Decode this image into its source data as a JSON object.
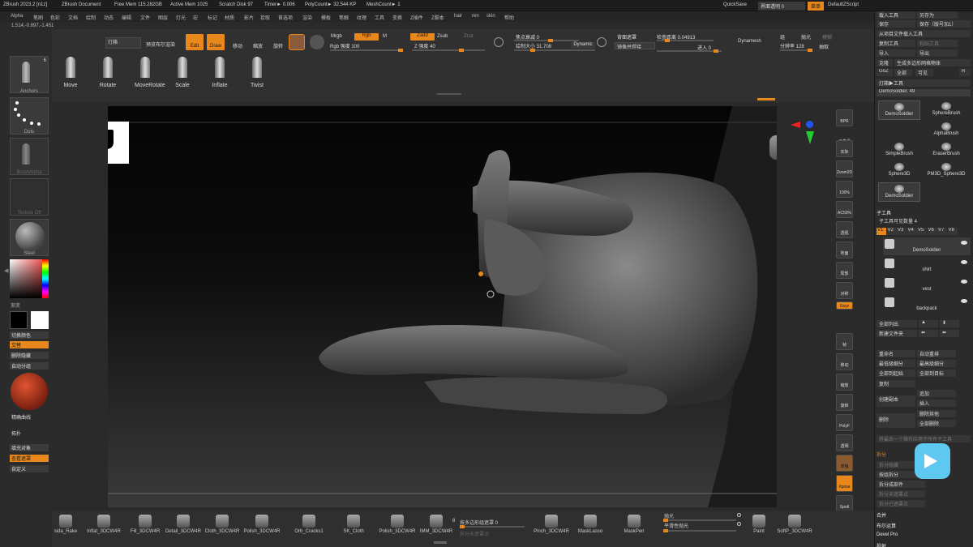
{
  "titlebar": {
    "app": "ZBrush 2023.2 [n1z]",
    "doc": "ZBrush Document",
    "freemem": "Free Mem 115.282GB",
    "activemem": "Active Mem 1025",
    "scratch": "Scratch Disk 97",
    "timer": "Timer► 0.006",
    "polycount": "PolyCount► 32.544 KP",
    "meshcount": "MeshCount► 1",
    "quicksave_label": "QuickSave",
    "transparency_label": "界面透明 0",
    "menu_label": "菜单",
    "script_label": "DefaultZScript"
  },
  "menu": [
    "Alpha",
    "笔刷",
    "色彩",
    "文档",
    "绘制",
    "动态",
    "编辑",
    "文件",
    "图层",
    "灯光",
    "宏",
    "标记",
    "材质",
    "影片",
    "拾取",
    "首选项",
    "渲染",
    "模板",
    "笔触",
    "纹理",
    "工具",
    "变换",
    "Z插件",
    "Z脚本",
    "hair",
    "ren",
    "skin",
    "帮助"
  ],
  "coords": "1.514,-0.897,-1.451",
  "top": {
    "lightbox": "灯箱",
    "preview": "预览布尔渲染",
    "edit": "Edit",
    "draw": "Draw",
    "move": "移动",
    "scale": "缩放",
    "rotate": "旋转",
    "mrgb": "Mrgb",
    "rgb": "Rgb",
    "m": "M",
    "rgb_intensity": "Rgb 强度 100",
    "zadd": "Zadd",
    "zsub": "Zsub",
    "zcut": "Zcut",
    "z_intensity": "Z 强度 40",
    "focal": "焦点衰减 0",
    "draw_size": "绘制大小 31.708",
    "dynamic": "Dynamic",
    "backface": "背面遮罩",
    "mirror": "镜像并焊接",
    "check_dist": "检查距离 0.04913",
    "advance": "进入 0",
    "dynamesh": "Dynamesh",
    "group": "组",
    "polish": "抛光",
    "resolution": "分辨率 128",
    "blur": "模糊",
    "extract": "抽取"
  },
  "brushes": [
    {
      "label": "Move"
    },
    {
      "label": "Rotate"
    },
    {
      "label": "MoveRotate"
    },
    {
      "label": "Scale"
    },
    {
      "label": "Inflate"
    },
    {
      "label": "Twist"
    }
  ],
  "left": {
    "anchors": "Anchors",
    "anchors_count": "6",
    "dots": "Dots",
    "brushalpha": "BrushAlpha",
    "textureoff": "Texture Off",
    "steel": "Steel",
    "gradient": "渐变",
    "swap_color": "切换颜色",
    "alternate": "交替",
    "delete_hide": "删除隐藏",
    "auto_group": "自动分组",
    "precise_curve": "精确曲线",
    "expand": "拓扑",
    "fill_object": "填充对象",
    "view_mask": "查看遮罩",
    "custom": "自定义"
  },
  "rtool": {
    "bpr": "BPR",
    "subpix": "子像素",
    "actual": "实际",
    "zoom2d": "Zoom2D",
    "pct100": "100%",
    "ac50": "AC50%",
    "persp": "透视",
    "floor": "地面",
    "local": "局部",
    "dynamic": "Dynamic",
    "sym": "对称",
    "xyz": "Gxyz",
    "frame": "帧",
    "move": "移动",
    "scale": "缩放",
    "rotate": "旋转",
    "polyf": "PolyF",
    "transp": "透明",
    "ghost": "幽灵",
    "solo": "单独",
    "xpose": "Xpose",
    "spotlight": "Spotl"
  },
  "rpanel": {
    "load": "载入工具",
    "saveas": "另存为",
    "save": "保存",
    "save_version": "保存（版号加1）",
    "import_proj": "从项目文件载入工具",
    "copy_tool": "复制工具",
    "paste": "粘贴工具",
    "import": "导入",
    "export": "导出",
    "clone": "克隆",
    "make_polymesh": "生成多边形网格物体",
    "goz": "GoZ",
    "all": "全部",
    "visible": "可见",
    "r": "R",
    "lightbox_tool": "灯箱▶工具",
    "current_tool": "DemoSoldier. 49",
    "tools": [
      {
        "label": "DemoSoldier"
      },
      {
        "label": "SphereBrush"
      },
      {
        "label": "AlphaBrush"
      },
      {
        "label": "SimpleBrush"
      },
      {
        "label": "EraserBrush"
      },
      {
        "label": "Sphere3D"
      },
      {
        "label": "PM3D_Sphere3D"
      },
      {
        "label": "DemoSoldier"
      }
    ],
    "subtool": "子工具",
    "subtool_count": "子工具可见数量 4",
    "vtabs": [
      "V1",
      "V2",
      "V3",
      "V4",
      "V5",
      "V6",
      "V7",
      "V8"
    ],
    "subtools": [
      {
        "label": "DemoSoldier"
      },
      {
        "label": "shirt"
      },
      {
        "label": "vest"
      },
      {
        "label": "backpack"
      }
    ],
    "list_all": "全部列出",
    "new_folder": "新建文件夹",
    "rename": "重命名",
    "auto_reorder": "自动重排",
    "lowest_res": "最低级细分",
    "highest_res": "最高级细分",
    "all_low": "全部到起始",
    "all_high": "全部到目标",
    "duplicate": "复制",
    "append": "追加",
    "insert": "插入",
    "create_copy": "创建副本",
    "delete": "删除",
    "delete_other": "删除其他",
    "delete_all": "全部删除",
    "merge_note": "将最后一个操作应用于所有子工具",
    "split": "拆分",
    "split_hidden": "拆分隐藏",
    "groups_split": "按组拆分",
    "split_parts": "拆分成部件",
    "split_unmasked": "拆分未遮罩点",
    "split_masked": "拆分已遮罩点",
    "merge": "合并",
    "boolean": "布尔运算",
    "remesh": "Devel Pro",
    "project": "投射"
  },
  "bottom": {
    "items": [
      {
        "label": "sida_Rake"
      },
      {
        "label": "Inflat_3DCW4R"
      },
      {
        "label": "Fill_3DCW4R"
      },
      {
        "label": "Detail_3DCW4R"
      },
      {
        "label": "Cloth_3DCW4R"
      },
      {
        "label": "Polish_3DCW4R"
      },
      {
        "label": "Orb_Cracks1"
      },
      {
        "label": "SK_Cloth"
      },
      {
        "label": "Polish_3DCW4R"
      },
      {
        "label": "IMM_3DCW4R"
      },
      {
        "label": "Pinch_3DCW4R"
      },
      {
        "label": "MaskLasso"
      },
      {
        "label": "MaskPen"
      },
      {
        "label": "Paint"
      },
      {
        "label": "SoftP_3DCW4R"
      }
    ],
    "polygroup": "按多边形组遮罩 0",
    "mask_unselected": "拆分未遮罩点",
    "smooth": "抛光",
    "smooth_weight": "平滑性抛光",
    "x": "8"
  },
  "colors": {
    "accent": "#e8871c",
    "panel": "#2b2b2b",
    "button": "#3a3a3a"
  }
}
